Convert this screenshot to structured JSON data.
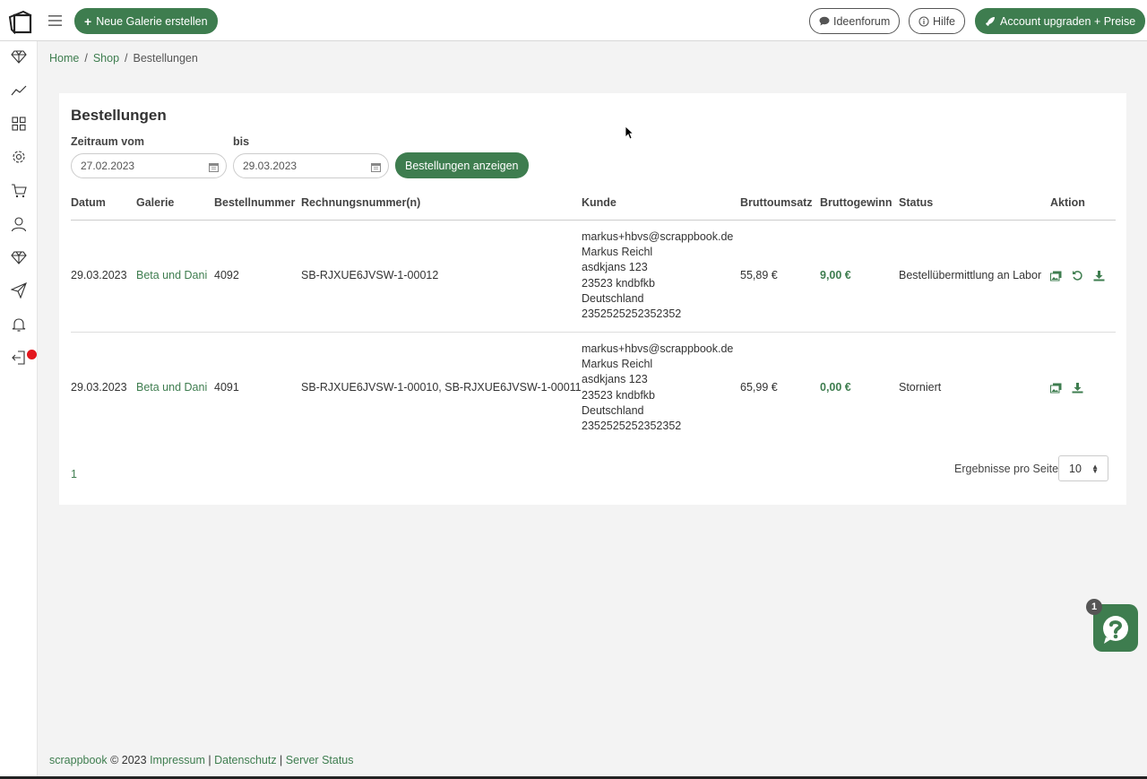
{
  "topbar": {
    "new_gallery": "Neue Galerie erstellen",
    "ideas": "Ideenforum",
    "help": "Hilfe",
    "upgrade": "Account upgraden + Preise"
  },
  "sidebar": {
    "icons": [
      "diamond-icon",
      "chart-line-icon",
      "grid-icon",
      "gear-icon",
      "cart-icon",
      "user-icon",
      "diamond-icon",
      "send-icon",
      "bell-icon",
      "logout-icon"
    ]
  },
  "breadcrumb": {
    "home": "Home",
    "shop": "Shop",
    "current": "Bestellungen",
    "sep": "/"
  },
  "page": {
    "title": "Bestellungen",
    "from_label": "Zeitraum vom",
    "to_label": "bis",
    "from_value": "27.02.2023",
    "to_value": "29.03.2023",
    "show_button": "Bestellungen anzeigen"
  },
  "table": {
    "headers": [
      "Datum",
      "Galerie",
      "Bestellnummer",
      "Rechnungsnummer(n)",
      "Kunde",
      "Bruttoumsatz",
      "Bruttogewinn",
      "Status",
      "Aktion"
    ],
    "rows": [
      {
        "date": "29.03.2023",
        "gallery": "Beta und Dani",
        "order": "4092",
        "invoices": "SB-RJXUE6JVSW-1-00012",
        "customer_email": "markus+hbvs@scrappbook.de",
        "customer_name": "Markus Reichl",
        "customer_street": "asdkjans 123",
        "customer_city": "23523 kndbfkb",
        "customer_country": "Deutschland",
        "customer_phone": "2352525252352352",
        "revenue": "55,89 €",
        "profit": "9,00 €",
        "status": "Bestellübermittlung an Labor"
      },
      {
        "date": "29.03.2023",
        "gallery": "Beta und Dani",
        "order": "4091",
        "invoices": "SB-RJXUE6JVSW-1-00010, SB-RJXUE6JVSW-1-00011",
        "customer_email": "markus+hbvs@scrappbook.de",
        "customer_name": "Markus Reichl",
        "customer_street": "asdkjans 123",
        "customer_city": "23523 kndbfkb",
        "customer_country": "Deutschland",
        "customer_phone": "2352525252352352",
        "revenue": "65,99 €",
        "profit": "0,00 €",
        "status": "Storniert"
      }
    ]
  },
  "pagination": {
    "page": "1",
    "per_page_label": "Ergebnisse pro Seite",
    "per_page_value": "10"
  },
  "footer": {
    "brand": "scrappbook",
    "copyright": " © 2023 ",
    "impressum": "Impressum",
    "sep": " | ",
    "privacy": "Datenschutz",
    "status": "Server Status"
  },
  "help_widget": {
    "badge": "1"
  },
  "colors": {
    "accent": "#3e7d4f",
    "notification": "#e3161d"
  }
}
